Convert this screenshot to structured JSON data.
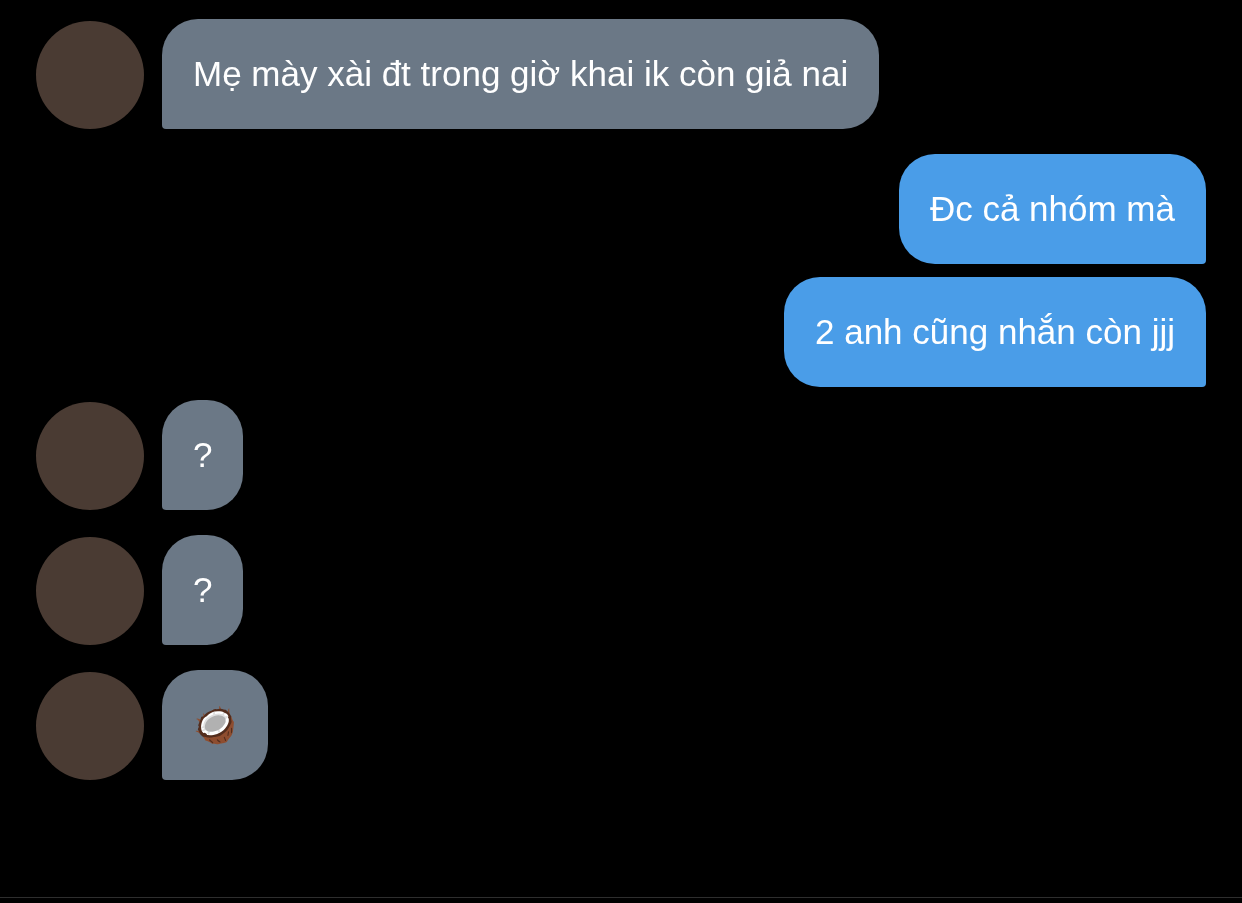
{
  "messages": [
    {
      "kind": "incoming",
      "text": "Mẹ mày xài đt trong giờ khai ik còn giả nai"
    },
    {
      "kind": "outgoing",
      "text": "Đc cả nhóm mà"
    },
    {
      "kind": "outgoing",
      "text": "2 anh cũng nhắn còn jjj"
    },
    {
      "kind": "incoming",
      "text": "?"
    },
    {
      "kind": "incoming",
      "text": "?"
    },
    {
      "kind": "incoming",
      "text": "🥥"
    }
  ]
}
